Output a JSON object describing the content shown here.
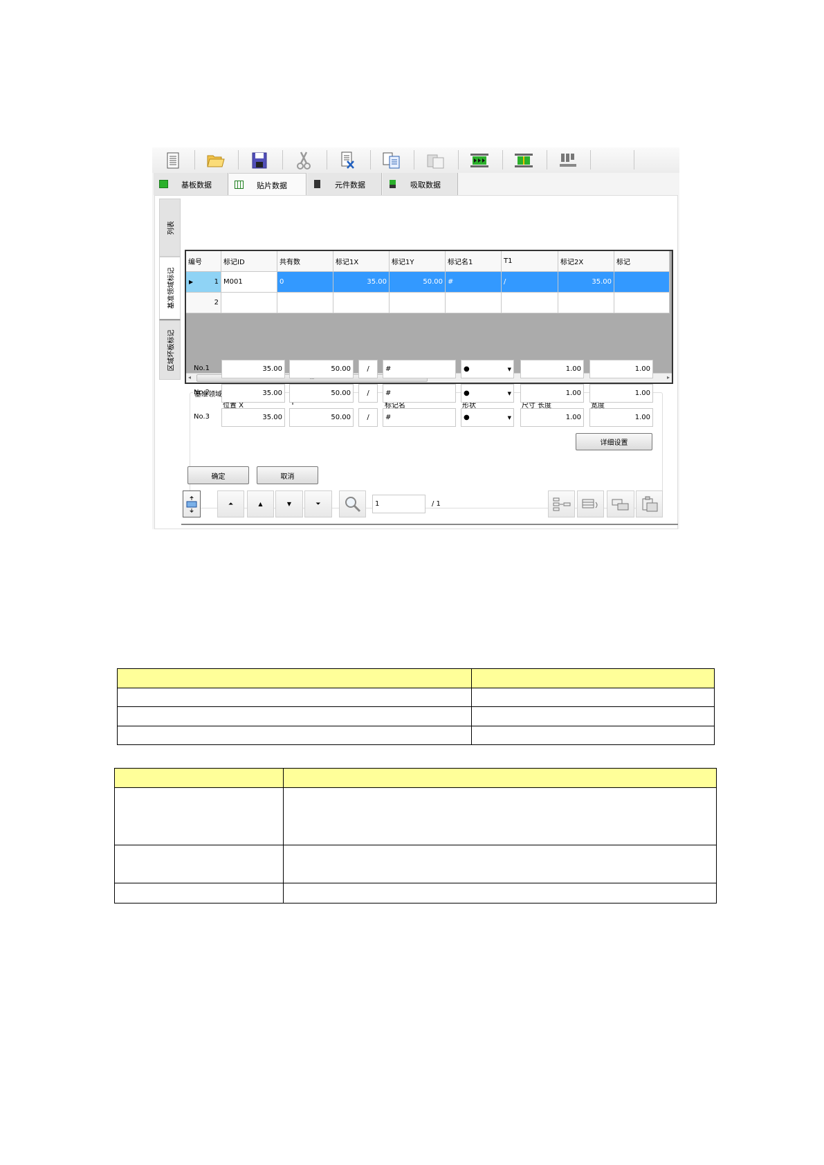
{
  "toolbar": {
    "icons": [
      "new-document-icon",
      "open-folder-icon",
      "save-icon",
      "cut-icon",
      "delete-document-icon",
      "copy-icon",
      "paste-icon",
      "conveyor-run-icon",
      "board-height-icon",
      "nozzle-icon"
    ]
  },
  "tabs": [
    {
      "label": "基板数据",
      "icon": "board-icon",
      "active": false
    },
    {
      "label": "贴片数据",
      "icon": "grid-table-icon",
      "active": true
    },
    {
      "label": "元件数据",
      "icon": "chip-icon",
      "active": false
    },
    {
      "label": "吸取数据",
      "icon": "nozzle-pickup-icon",
      "active": false
    }
  ],
  "side_tabs": [
    {
      "label": "列表",
      "active": false
    },
    {
      "label": "基准领域标记",
      "active": true
    },
    {
      "label": "区域坏板标记",
      "active": false
    }
  ],
  "grid": {
    "columns": [
      "编号",
      "标记ID",
      "共有数",
      "标记1X",
      "标记1Y",
      "标记名1",
      "T1",
      "标记2X",
      "标记"
    ],
    "rows": [
      {
        "no": "1",
        "id": "M001",
        "count": "0",
        "x1": "35.00",
        "y1": "50.00",
        "name1": "#",
        "t1": "/",
        "x2": "35.00",
        "selected": true
      },
      {
        "no": "2",
        "id": "",
        "count": "",
        "x1": "",
        "y1": "",
        "name1": "",
        "t1": "",
        "x2": "",
        "selected": false
      }
    ],
    "scroll_grip": "III"
  },
  "group": {
    "title": "基准领域标记(No.1)",
    "col_x": "位置 X",
    "col_y": "Y",
    "col_name": "标记名",
    "col_shape": "形状",
    "col_length": "尺寸 长度",
    "col_width": "宽度",
    "rows": [
      {
        "label": "No.1",
        "x": "35.00",
        "y": "50.00",
        "sep": "/",
        "name": "#",
        "shape": "●",
        "length": "1.00",
        "width": "1.00"
      },
      {
        "label": "No.2",
        "x": "35.00",
        "y": "50.00",
        "sep": "/",
        "name": "#",
        "shape": "●",
        "length": "1.00",
        "width": "1.00"
      },
      {
        "label": "No.3",
        "x": "35.00",
        "y": "50.00",
        "sep": "/",
        "name": "#",
        "shape": "●",
        "length": "1.00",
        "width": "1.00"
      }
    ],
    "detail_button": "详细设置"
  },
  "ok_button": "确定",
  "cancel_button": "取消",
  "pager": {
    "current": "1",
    "total": "/ 1"
  },
  "colors": {
    "selection": "#3399ff",
    "row_header_selected": "#8fd3f5",
    "table_header": "#ffff99"
  }
}
